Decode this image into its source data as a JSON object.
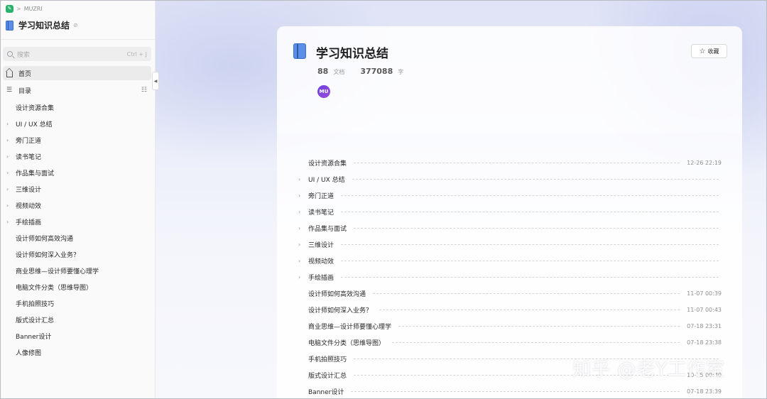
{
  "breadcrumb": {
    "workspace": "MUZRI"
  },
  "knowledge_base": {
    "title": "学习知识总结",
    "lock_icon": "lock-icon"
  },
  "search": {
    "placeholder": "搜索",
    "shortcut": "Ctrl + J"
  },
  "nav": {
    "home": "首页",
    "toc": "目录"
  },
  "sidebar_tree": [
    {
      "label": "设计资源合集",
      "expandable": false
    },
    {
      "label": "UI / UX 总结",
      "expandable": true
    },
    {
      "label": "旁门正道",
      "expandable": true
    },
    {
      "label": "读书笔记",
      "expandable": true
    },
    {
      "label": "作品集与面试",
      "expandable": true
    },
    {
      "label": "三维设计",
      "expandable": true
    },
    {
      "label": "视频动效",
      "expandable": true
    },
    {
      "label": "手绘插画",
      "expandable": true
    },
    {
      "label": "设计师如何高效沟通",
      "expandable": false
    },
    {
      "label": "设计师如何深入业务？",
      "expandable": false
    },
    {
      "label": "商业思维—设计师要懂心理学",
      "expandable": false
    },
    {
      "label": "电脑文件分类（思维导图）",
      "expandable": false
    },
    {
      "label": "手机拍照技巧",
      "expandable": false
    },
    {
      "label": "版式设计汇总",
      "expandable": false
    },
    {
      "label": "Banner设计",
      "expandable": false
    },
    {
      "label": "人像修图",
      "expandable": false
    }
  ],
  "main": {
    "title": "学习知识总结",
    "favorite_label": "收藏",
    "doc_count": "88",
    "doc_unit": "文档",
    "word_count": "377088",
    "word_unit": "字",
    "avatar_text": "MU"
  },
  "toc": [
    {
      "label": "设计资源合集",
      "expandable": false,
      "date": "12-26 22:19"
    },
    {
      "label": "UI / UX 总结",
      "expandable": true,
      "date": ""
    },
    {
      "label": "旁门正道",
      "expandable": true,
      "date": ""
    },
    {
      "label": "读书笔记",
      "expandable": true,
      "date": ""
    },
    {
      "label": "作品集与面试",
      "expandable": true,
      "date": ""
    },
    {
      "label": "三维设计",
      "expandable": true,
      "date": ""
    },
    {
      "label": "视频动效",
      "expandable": true,
      "date": ""
    },
    {
      "label": "手绘插画",
      "expandable": true,
      "date": ""
    },
    {
      "label": "设计师如何高效沟通",
      "expandable": false,
      "date": "11-07 00:39"
    },
    {
      "label": "设计师如何深入业务？",
      "expandable": false,
      "date": "11-07 00:43"
    },
    {
      "label": "商业思维—设计师要懂心理学",
      "expandable": false,
      "date": "07-18 23:31"
    },
    {
      "label": "电脑文件分类（思维导图）",
      "expandable": false,
      "date": "07-18 23:38"
    },
    {
      "label": "手机拍照技巧",
      "expandable": false,
      "date": ""
    },
    {
      "label": "版式设计汇总",
      "expandable": false,
      "date": "10-15 00:40"
    },
    {
      "label": "Banner设计",
      "expandable": false,
      "date": "07-18 23:39"
    }
  ],
  "watermark": "知乎 @老Y工作室"
}
